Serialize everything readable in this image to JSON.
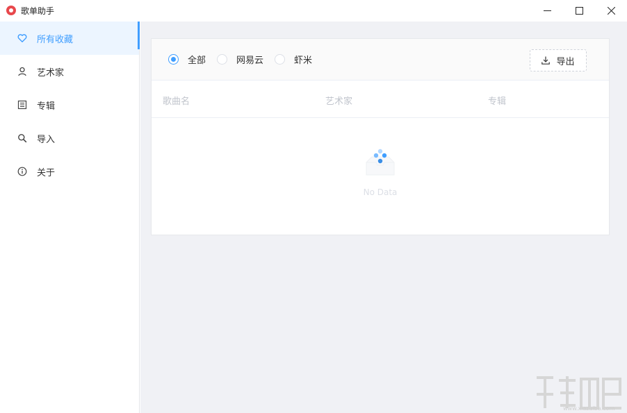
{
  "window": {
    "title": "歌单助手",
    "controls": [
      "minimize-icon",
      "maximize-icon",
      "close-icon"
    ]
  },
  "sidebar": {
    "items": [
      {
        "label": "所有收藏",
        "icon": "heart-icon",
        "active": true
      },
      {
        "label": "艺术家",
        "icon": "user-icon",
        "active": false
      },
      {
        "label": "专辑",
        "icon": "album-icon",
        "active": false
      },
      {
        "label": "导入",
        "icon": "search-icon",
        "active": false
      },
      {
        "label": "关于",
        "icon": "info-icon",
        "active": false
      }
    ]
  },
  "filter": {
    "options": [
      {
        "label": "全部",
        "checked": true
      },
      {
        "label": "网易云",
        "checked": false
      },
      {
        "label": "虾米",
        "checked": false
      }
    ],
    "export_label": "导出"
  },
  "table": {
    "columns": [
      "歌曲名",
      "艺术家",
      "专辑"
    ],
    "rows": [],
    "empty_text": "No Data"
  },
  "watermark": {
    "url": "www.xiazaiba.com"
  },
  "colors": {
    "accent": "#409eff",
    "background": "#f0f1f5",
    "active_bg": "#ecf5ff"
  }
}
